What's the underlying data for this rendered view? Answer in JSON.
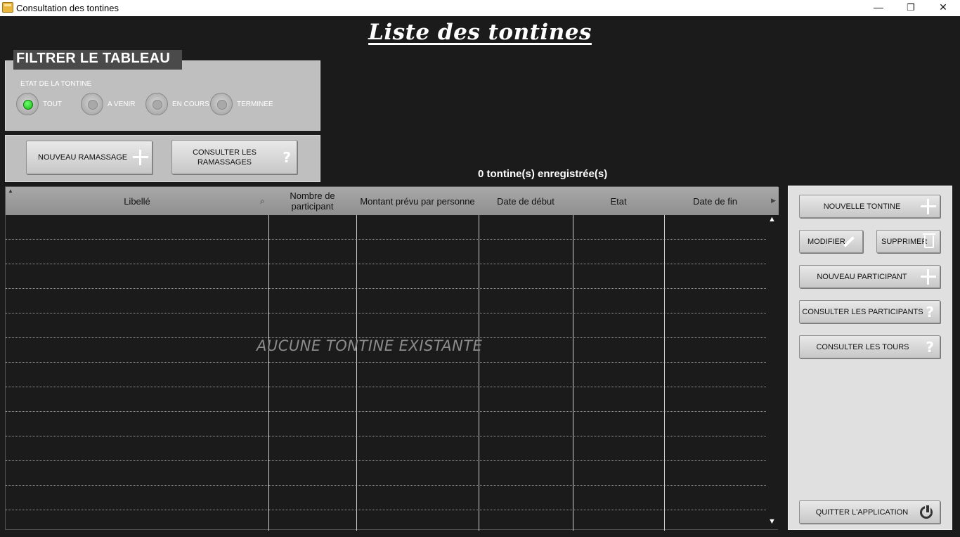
{
  "window": {
    "title": "Consultation des tontines",
    "minimize": "—",
    "restore": "❐",
    "close": "✕"
  },
  "page": {
    "heading": "Liste des tontines"
  },
  "filter": {
    "legend": "FILTRER LE TABLEAU",
    "group_label": "ETAT DE LA TONTINE",
    "options": [
      {
        "label": "TOUT",
        "selected": true
      },
      {
        "label": "A VENIR",
        "selected": false
      },
      {
        "label": "EN COURS",
        "selected": false
      },
      {
        "label": "TERMINEE",
        "selected": false
      }
    ]
  },
  "actions": {
    "new_collection": "NOUVEAU RAMASSAGE",
    "view_collections": "CONSULTER LES RAMASSAGES"
  },
  "table": {
    "count_label": "0 tontine(s) enregistrée(s)",
    "columns": [
      "Libellé",
      "Nombre de participant",
      "Montant prévu par personne",
      "Date de début",
      "Etat",
      "Date de fin"
    ],
    "rows": [],
    "empty_message": "AUCUNE TONTINE EXISTANTE"
  },
  "sidebar": {
    "new_tontine": "NOUVELLE TONTINE",
    "edit": "MODIFIER",
    "delete": "SUPPRIMER",
    "new_participant": "NOUVEAU PARTICIPANT",
    "view_participants": "CONSULTER LES PARTICIPANTS",
    "view_rounds": "CONSULTER LES TOURS",
    "quit": "QUITTER L'APPLICATION"
  },
  "icons": {
    "filter_selected": "green-radio",
    "add": "plus-icon",
    "help": "question-icon",
    "edit": "pencil-icon",
    "delete": "trash-icon",
    "quit": "power-icon"
  },
  "colors": {
    "background": "#1b1b1b",
    "panel": "#bfbfbf",
    "sidebar": "#e0e0e0",
    "selected_radio": "#11b811"
  }
}
